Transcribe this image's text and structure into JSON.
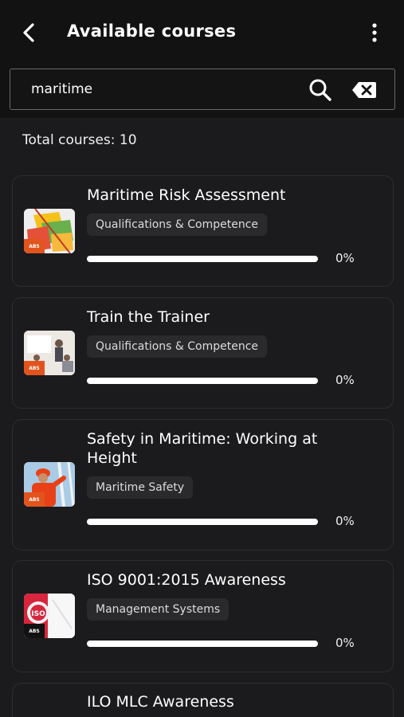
{
  "header": {
    "title": "Available courses"
  },
  "search": {
    "value": "maritime",
    "placeholder": ""
  },
  "summary": {
    "total_text": "Total courses: 10"
  },
  "courses": [
    {
      "title": "Maritime Risk Assessment",
      "category": "Qualifications & Competence",
      "progress": 0,
      "progress_text": "0%"
    },
    {
      "title": "Train the Trainer",
      "category": "Qualifications & Competence",
      "progress": 0,
      "progress_text": "0%"
    },
    {
      "title": "Safety in Maritime: Working at Height",
      "category": "Maritime Safety",
      "progress": 0,
      "progress_text": "0%"
    },
    {
      "title": "ISO 9001:2015 Awareness",
      "category": "Management Systems",
      "progress": 0,
      "progress_text": "0%"
    },
    {
      "title": "ILO MLC Awareness"
    }
  ],
  "thumbnail_logo_text": "ABS",
  "colors": {
    "background": "#1b1b1d",
    "header": "#121213",
    "accent": "#e2541d",
    "tag_background": "#2a2a2d"
  },
  "icons": {
    "back": "back-arrow-icon",
    "more": "more-vertical-icon",
    "search": "search-icon",
    "clear": "backspace-clear-icon"
  }
}
